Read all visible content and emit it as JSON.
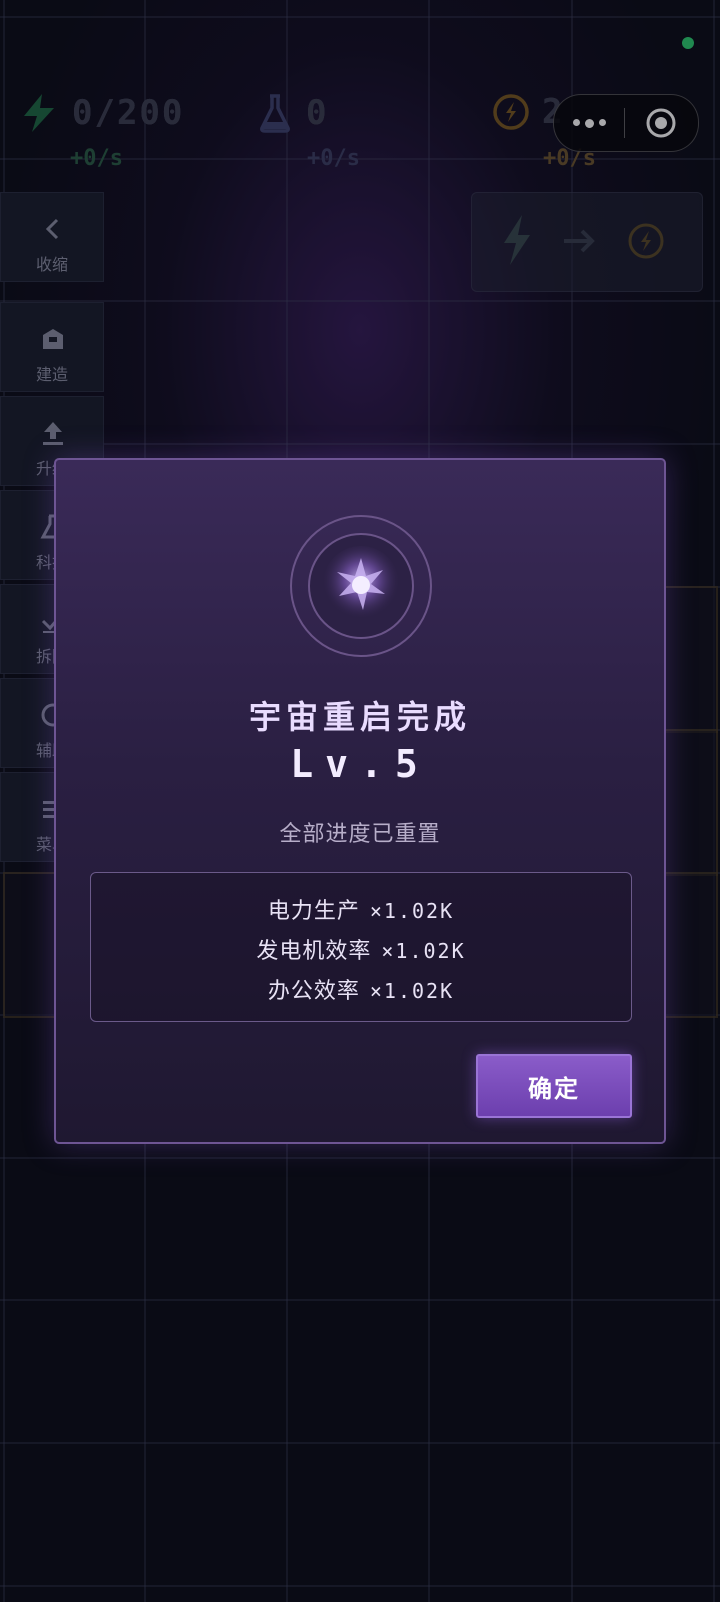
{
  "resources": [
    {
      "name": "power",
      "icon": "lightning-icon",
      "value": "0/200",
      "rate": "+0/s",
      "color": "#2e8a5b"
    },
    {
      "name": "research",
      "icon": "flask-icon",
      "value": "0",
      "rate": "+0/s",
      "color": "#4a4f7a"
    },
    {
      "name": "coin",
      "icon": "coin-icon",
      "value": "2",
      "rate": "+0/s",
      "color": "#8a6a2a"
    }
  ],
  "side_menu": [
    {
      "label": "收缩",
      "icon": "chevron-left-icon"
    },
    {
      "label": "建造",
      "icon": "build-icon"
    },
    {
      "label": "升级",
      "icon": "upload-icon"
    },
    {
      "label": "科技",
      "icon": "flask-icon"
    },
    {
      "label": "拆除",
      "icon": "check-icon"
    },
    {
      "label": "辅助",
      "icon": "circle-icon"
    },
    {
      "label": "菜单",
      "icon": "menu-icon"
    }
  ],
  "dialog": {
    "title": "宇宙重启完成",
    "level": "Lv.5",
    "subtitle": "全部进度已重置",
    "bonuses": [
      {
        "name": "电力生产",
        "multiplier": "×1.02K"
      },
      {
        "name": "发电机效率",
        "multiplier": "×1.02K"
      },
      {
        "name": "办公效率",
        "multiplier": "×1.02K"
      }
    ],
    "confirm_label": "确定"
  },
  "colors": {
    "accent": "#7b4fc0",
    "dialog_border": "#6e5594",
    "status_dot": "#2fd072"
  }
}
